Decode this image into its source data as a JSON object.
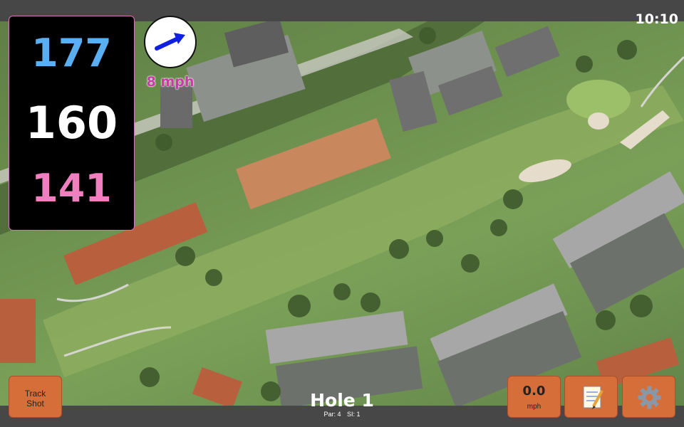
{
  "status": {
    "time": "10:10"
  },
  "distances": {
    "back": "177",
    "middle": "160",
    "front": "141"
  },
  "wind": {
    "speed_label": "8 mph",
    "direction_icon": "wind-arrow-icon"
  },
  "buttons": {
    "track_shot_line1": "Track",
    "track_shot_line2": "Shot",
    "speed_value": "0.0",
    "speed_unit": "mph",
    "notes_icon": "notepad-icon",
    "settings_icon": "gear-icon"
  },
  "hole": {
    "title": "Hole 1",
    "par": "Par: 4",
    "si": "SI: 1"
  },
  "colors": {
    "back": "#5aaef2",
    "middle": "#ffffff",
    "front": "#ef7fbf",
    "button": "#d66e3a",
    "wind_text": "#c83aa8"
  }
}
